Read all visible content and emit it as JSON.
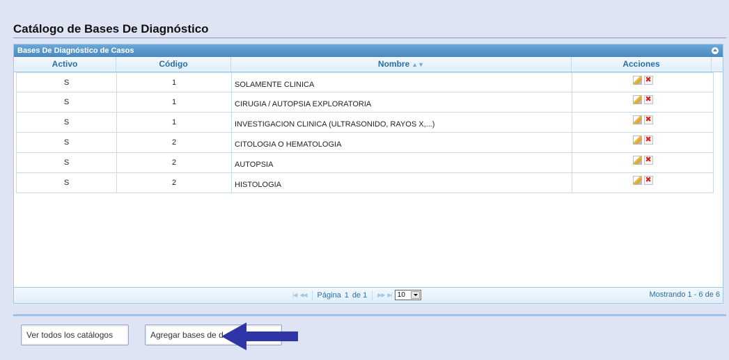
{
  "page": {
    "title": "Catálogo de Bases De Diagnóstico"
  },
  "grid": {
    "caption": "Bases De Diagnóstico de Casos",
    "columns": {
      "activo": "Activo",
      "codigo": "Código",
      "nombre": "Nombre",
      "acciones": "Acciones"
    },
    "sort_indicator": "▲▼",
    "rows": [
      {
        "activo": "S",
        "codigo": "1",
        "nombre": "SOLAMENTE CLINICA"
      },
      {
        "activo": "S",
        "codigo": "1",
        "nombre": "CIRUGIA / AUTOPSIA EXPLORATORIA"
      },
      {
        "activo": "S",
        "codigo": "1",
        "nombre": "INVESTIGACION CLINICA (ULTRASONIDO, RAYOS X,...)"
      },
      {
        "activo": "S",
        "codigo": "2",
        "nombre": "CITOLOGIA O HEMATOLOGIA"
      },
      {
        "activo": "S",
        "codigo": "2",
        "nombre": "AUTOPSIA"
      },
      {
        "activo": "S",
        "codigo": "2",
        "nombre": "HISTOLOGIA"
      }
    ],
    "row_actions": [
      "edit-icon",
      "delete-icon"
    ]
  },
  "pager": {
    "page_label": "Página",
    "page_value": "1",
    "of_label": "de 1",
    "rows_per_page": "10",
    "record_text": "Mostrando 1 - 6 de 6"
  },
  "buttons": {
    "ver_todos": "Ver todos los catálogos",
    "agregar": "Agregar bases de d"
  },
  "colors": {
    "background": "#dfe4f5",
    "caption_bar": "#4a88c0",
    "arrow": "#2f35a6"
  }
}
